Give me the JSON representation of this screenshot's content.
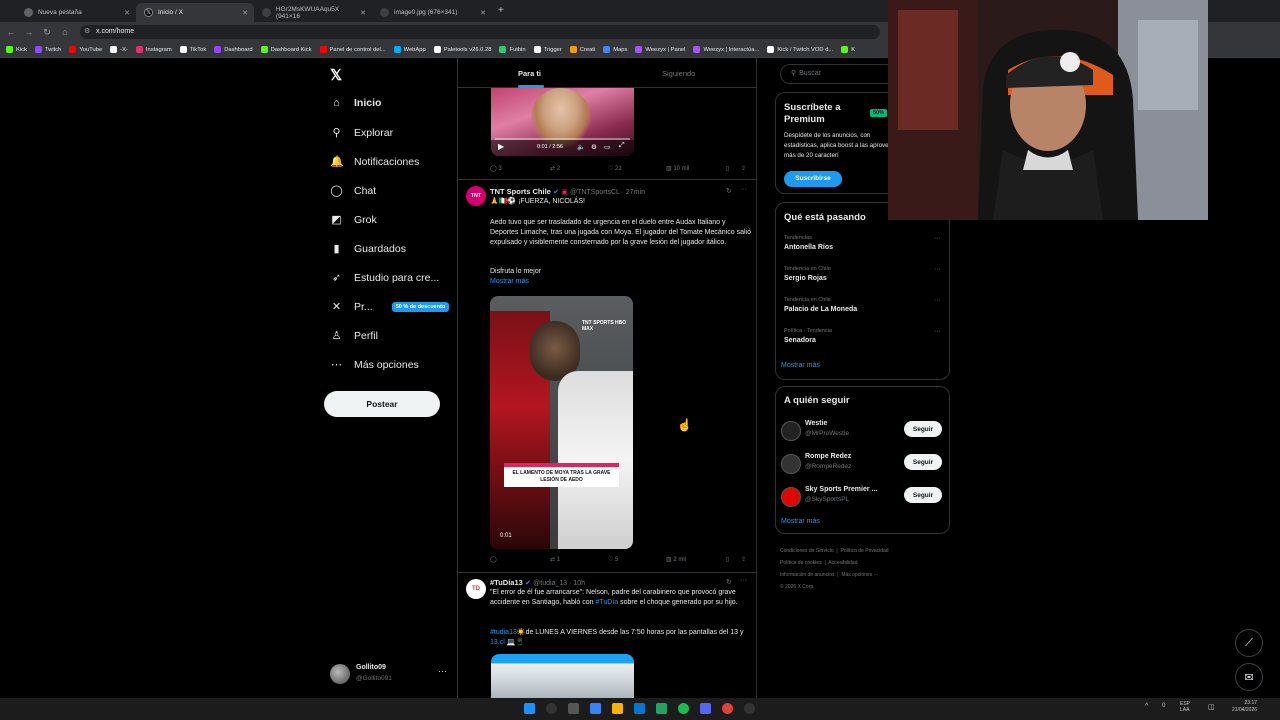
{
  "browser": {
    "tabs": [
      {
        "label": "Nueva pestaña"
      },
      {
        "label": "Inicio / X"
      },
      {
        "label": "HGr2MsKWUAAqu5X (941×16"
      },
      {
        "label": "image0.jpg (676×341)"
      }
    ],
    "url": "x.com/home",
    "bookmarks": [
      {
        "label": "Kick",
        "color": "#53fc18"
      },
      {
        "label": "Twitch",
        "color": "#9146ff"
      },
      {
        "label": "YouTube",
        "color": "#ff0000"
      },
      {
        "label": "-X-",
        "color": "#ffffff"
      },
      {
        "label": "Instagram",
        "color": "#e1306c"
      },
      {
        "label": "TikTok",
        "color": "#ffffff"
      },
      {
        "label": "Dashboard",
        "color": "#9146ff"
      },
      {
        "label": "Dashboard Kick",
        "color": "#53fc18"
      },
      {
        "label": "Panel de control del...",
        "color": "#ff0000"
      },
      {
        "label": "WebApp",
        "color": "#00b0ff"
      },
      {
        "label": "Paletools v26.0.28",
        "color": "#ffffff"
      },
      {
        "label": "Futbin",
        "color": "#2ecc71"
      },
      {
        "label": "Trigger",
        "color": "#ffffff"
      },
      {
        "label": "Creati",
        "color": "#f39c12"
      },
      {
        "label": "Maps",
        "color": "#4285f4"
      },
      {
        "label": "Weezyx | Panel",
        "color": "#a855f7"
      },
      {
        "label": "Weezyx | Interactúa...",
        "color": "#a855f7"
      },
      {
        "label": "Kick / Twitch VOD d...",
        "color": "#ffffff"
      },
      {
        "label": "K",
        "color": "#53fc18"
      }
    ]
  },
  "sidebar": {
    "items": [
      {
        "label": "Inicio",
        "icon": "home-icon",
        "glyph": "⌂"
      },
      {
        "label": "Explorar",
        "icon": "search-icon",
        "glyph": "⚲"
      },
      {
        "label": "Notificaciones",
        "icon": "bell-icon",
        "glyph": "🔔"
      },
      {
        "label": "Chat",
        "icon": "chat-icon",
        "glyph": "◯"
      },
      {
        "label": "Grok",
        "icon": "grok-icon",
        "glyph": "◩"
      },
      {
        "label": "Guardados",
        "icon": "bookmark-icon",
        "glyph": "▮"
      },
      {
        "label": "Estudio para cre...",
        "icon": "rocket-icon",
        "glyph": "➶"
      },
      {
        "label": "Pr...",
        "icon": "x-premium-icon",
        "glyph": "✕"
      },
      {
        "label": "Perfil",
        "icon": "person-icon",
        "glyph": "♙"
      },
      {
        "label": "Más opciones",
        "icon": "more-icon",
        "glyph": "⋯"
      }
    ],
    "promo_badge": "50 % de descuento",
    "post_button": "Postear",
    "account": {
      "name": "Gollito09",
      "handle": "@Gollito091"
    }
  },
  "feed": {
    "tabs": [
      "Para ti",
      "Siguiendo"
    ],
    "video1": {
      "time": "0:01 / 2:56"
    },
    "tweet0_actions": {
      "replies": "3",
      "reposts": "2",
      "likes": "21",
      "views": "10 mil"
    },
    "tweet1": {
      "name": "TNT Sports Chile",
      "handle": "@TNTSportsCL · 27min",
      "title": "🙏🇮🇹⚽ ¡FUERZA, NICOLÁS!",
      "body": "Aedo tuvo que ser trasladado de urgencia en el duelo entre Audax Italiano y Deportes Limache, tras una jugada con Moya. El jugador del Tomate Mecánico salió expulsado y visiblemente consternado por la grave lesión del jugador itálico.",
      "extra": "Disfruta lo mejor",
      "show_more": "Mostrar más",
      "video_caption": "EL LAMENTO DE MOYA TRAS LA GRAVE LESIÓN DE AEDO",
      "video_time": "0:01",
      "actions": {
        "replies": "",
        "reposts": "1",
        "likes": "5",
        "views": "2 mil"
      }
    },
    "tweet2": {
      "name": "#TuDía13",
      "handle": "@tudia_13 · 10h",
      "body_pre": "\"El error de él fue arrancarse\": Nelson, padre del carabinero que provocó grave accidente en Santiago, habló con ",
      "body_link": "#TuDía",
      "body_post": " sobre el choque generado por su hijo.",
      "line2_link": "#tudia13",
      "line2": "☀️de LUNES A VIERNES desde las 7:50 horas por las pantallas del 13 y ",
      "line2_link2": "13.cl",
      "line2_end": " 💻📱"
    }
  },
  "right": {
    "search_placeholder": "Buscar",
    "premium": {
      "title": "Suscríbete a Premium",
      "badge": "50%",
      "body": "Despídete de los anuncios, con estadísticas, aplica boost a las aprovecha más de 20 caracterí",
      "button": "Suscribirse"
    },
    "trends": {
      "title": "Qué está pasando",
      "items": [
        {
          "meta": "Tendencias",
          "name": "Antonella Ríos"
        },
        {
          "meta": "Tendencia en Chile",
          "name": "Sergio Rojas"
        },
        {
          "meta": "Tendencia en Chile",
          "name": "Palacio de La Moneda"
        },
        {
          "meta": "Política · Tendencia",
          "name": "Senadora"
        }
      ],
      "show_more": "Mostrar más"
    },
    "who_to_follow": {
      "title": "A quién seguir",
      "items": [
        {
          "name": "Westie",
          "handle": "@MrProWestie",
          "button": "Seguir"
        },
        {
          "name": "Rompe Redez",
          "handle": "@RompeRedez",
          "button": "Seguir"
        },
        {
          "name": "Sky Sports Premier ...",
          "handle": "@SkySportsPL",
          "button": "Seguir"
        }
      ],
      "show_more": "Mostrar más"
    },
    "footer": [
      "Condiciones de Servicio",
      "Política de Privacidad",
      "Política de cookies",
      "Accesibilidad",
      "Información de anuncios",
      "Más opciones ···",
      "© 2026 X Corp."
    ]
  },
  "taskbar": {
    "lang": "ESP",
    "lang2": "LAA",
    "time": "23:17",
    "date": "21/04/2026",
    "volume": "0"
  }
}
